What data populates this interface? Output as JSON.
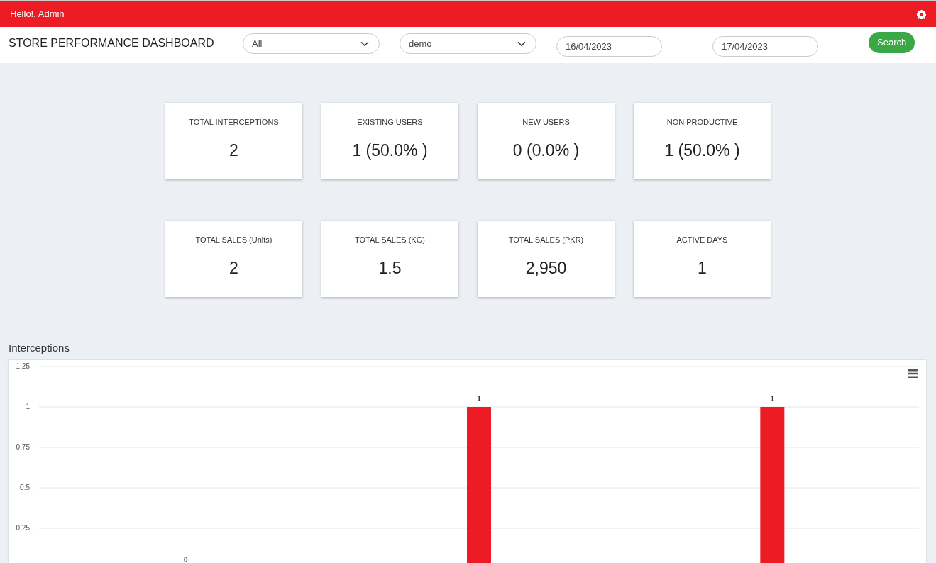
{
  "topbar": {
    "greeting": "Hello!, Admin"
  },
  "header": {
    "title": "STORE PERFORMANCE DASHBOARD",
    "filters": [
      {
        "kind": "select",
        "value": "All"
      },
      {
        "kind": "select",
        "value": "demo"
      },
      {
        "kind": "date",
        "value": "16/04/2023"
      },
      {
        "kind": "date",
        "value": "17/04/2023"
      }
    ],
    "search_button": "Search"
  },
  "stat_rows": [
    [
      {
        "label": "TOTAL INTERCEPTIONS",
        "value": "2"
      },
      {
        "label": "EXISTING USERS",
        "value": "1 (50.0% )"
      },
      {
        "label": "NEW USERS",
        "value": "0 (0.0% )"
      },
      {
        "label": "NON PRODUCTIVE",
        "value": "1 (50.0% )"
      }
    ],
    [
      {
        "label": "TOTAL SALES (Units)",
        "value": "2"
      },
      {
        "label": "TOTAL SALES (KG)",
        "value": "1.5"
      },
      {
        "label": "TOTAL SALES (PKR)",
        "value": "2,950"
      },
      {
        "label": "ACTIVE DAYS",
        "value": "1"
      }
    ]
  ],
  "interceptions": {
    "title": "Interceptions",
    "chart_data": {
      "type": "bar",
      "ylim": [
        0,
        1.25
      ],
      "yticks": [
        {
          "value": 0.25,
          "label": "0.25"
        },
        {
          "value": 0.5,
          "label": "0.5"
        },
        {
          "value": 0.75,
          "label": "0.75"
        },
        {
          "value": 1,
          "label": "1"
        },
        {
          "value": 1.25,
          "label": "1.25"
        }
      ],
      "grid": true,
      "series": [
        {
          "color": "#ed1c24",
          "values": [
            0,
            1,
            1
          ]
        }
      ],
      "data_labels": true
    }
  }
}
